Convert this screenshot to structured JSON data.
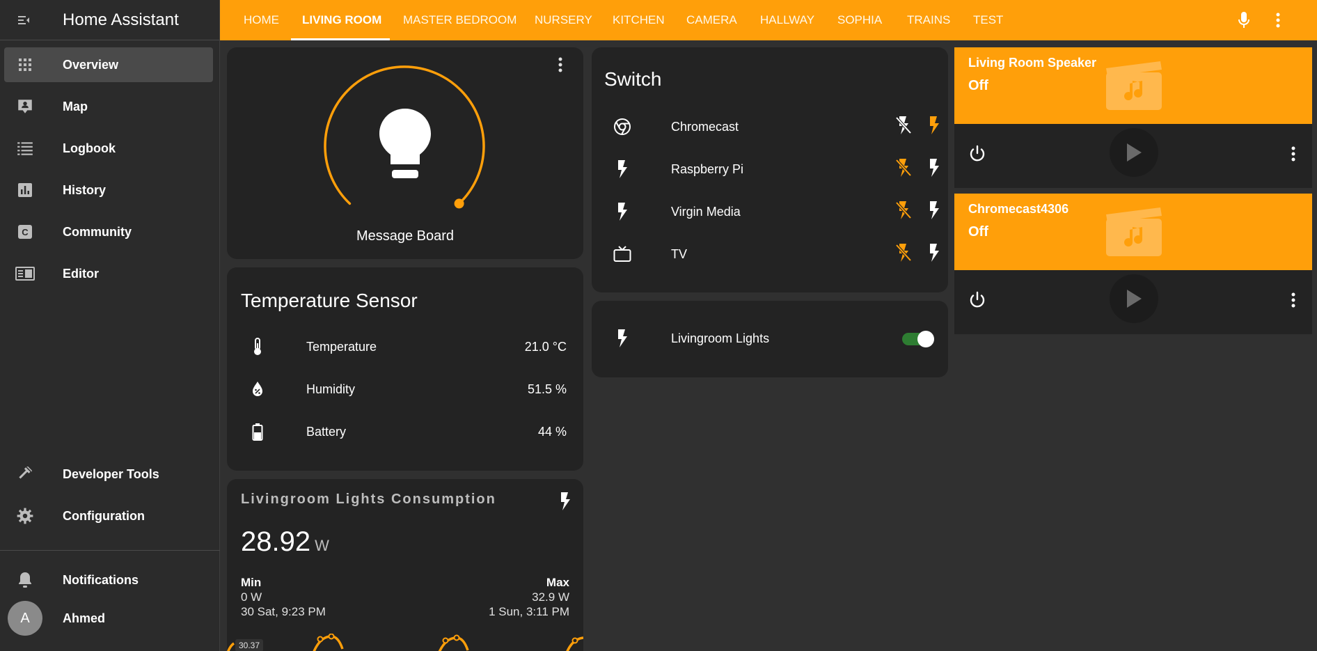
{
  "app": {
    "title": "Home Assistant"
  },
  "sidebar": {
    "items": [
      {
        "label": "Overview",
        "icon": "grid-icon"
      },
      {
        "label": "Map",
        "icon": "map-person-icon"
      },
      {
        "label": "Logbook",
        "icon": "list-icon"
      },
      {
        "label": "History",
        "icon": "chart-icon"
      },
      {
        "label": "Community",
        "icon": "community-icon"
      },
      {
        "label": "Editor",
        "icon": "editor-icon"
      }
    ],
    "bottom_items": [
      {
        "label": "Developer Tools",
        "icon": "hammer-icon"
      },
      {
        "label": "Configuration",
        "icon": "gear-icon"
      }
    ],
    "notifications_label": "Notifications",
    "user": {
      "initial": "A",
      "name": "Ahmed"
    }
  },
  "tabs": [
    "HOME",
    "LIVING ROOM",
    "MASTER BEDROOM",
    "NURSERY",
    "KITCHEN",
    "CAMERA",
    "HALLWAY",
    "SOPHIA",
    "TRAINS",
    "TEST"
  ],
  "active_tab": "LIVING ROOM",
  "light_card": {
    "name": "Message Board"
  },
  "temperature_card": {
    "title": "Temperature Sensor",
    "rows": [
      {
        "name": "Temperature",
        "value": "21.0 °C",
        "icon": "thermometer-icon"
      },
      {
        "name": "Humidity",
        "value": "51.5 %",
        "icon": "water-percent-icon"
      },
      {
        "name": "Battery",
        "value": "44 %",
        "icon": "battery-icon"
      }
    ]
  },
  "consumption_card": {
    "title": "Livingroom Lights Consumption",
    "value": "28.92",
    "unit": "W",
    "min_label": "Min",
    "min_value": "0 W",
    "min_time": "30 Sat, 9:23 PM",
    "max_label": "Max",
    "max_value": "32.9 W",
    "max_time": "1 Sun, 3:11 PM",
    "graph_label": "30.37"
  },
  "switch_card": {
    "title": "Switch",
    "rows": [
      {
        "name": "Chromecast",
        "icon": "chrome-icon"
      },
      {
        "name": "Raspberry Pi",
        "icon": "flash-icon"
      },
      {
        "name": "Virgin Media",
        "icon": "flash-icon"
      },
      {
        "name": "TV",
        "icon": "tv-icon"
      }
    ]
  },
  "lights_card": {
    "name": "Livingroom Lights",
    "state": "on"
  },
  "media_players": [
    {
      "name": "Living Room Speaker",
      "state": "Off"
    },
    {
      "name": "Chromecast4306",
      "state": "Off"
    }
  ],
  "colors": {
    "accent": "#ff9f0a",
    "card": "#232323",
    "background": "#303030",
    "sidebar": "#2b2b2b",
    "toggle_on": "#2e7d32"
  }
}
